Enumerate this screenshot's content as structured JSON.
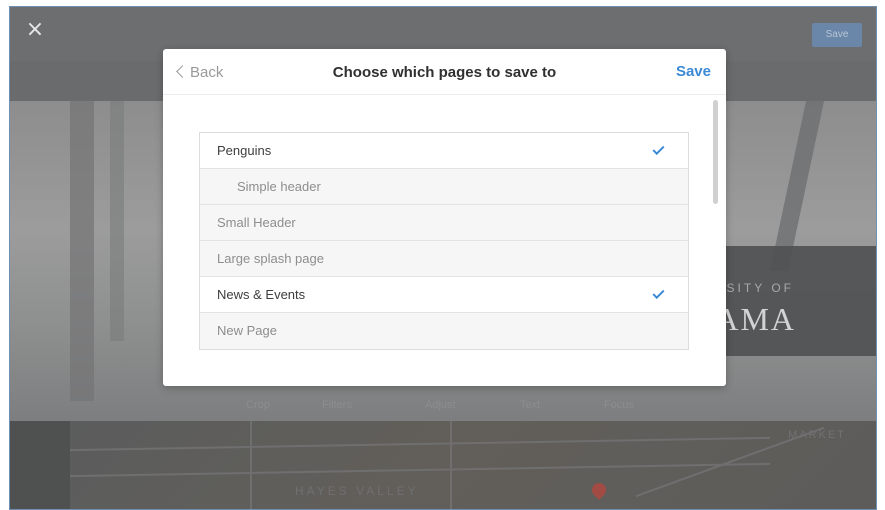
{
  "editor": {
    "close_icon": "close-icon",
    "save_label": "Save",
    "tools": [
      "Crop",
      "Filters",
      "Adjust",
      "Text",
      "Focus"
    ],
    "photo_text_small": "RSITY OF",
    "photo_text_big": "AMA",
    "map_labels": {
      "hayes": "HAYES VALLEY",
      "market": "MARKET"
    }
  },
  "modal": {
    "back_label": "Back",
    "title": "Choose which pages to save to",
    "save_label": "Save",
    "accent_color": "#3a8ad6",
    "pages": [
      {
        "label": "Penguins",
        "checked": true,
        "indent": false
      },
      {
        "label": "Simple header",
        "checked": false,
        "indent": true
      },
      {
        "label": "Small Header",
        "checked": false,
        "indent": false
      },
      {
        "label": "Large splash page",
        "checked": false,
        "indent": false
      },
      {
        "label": "News & Events",
        "checked": true,
        "indent": false
      },
      {
        "label": "New Page",
        "checked": false,
        "indent": false
      }
    ]
  }
}
